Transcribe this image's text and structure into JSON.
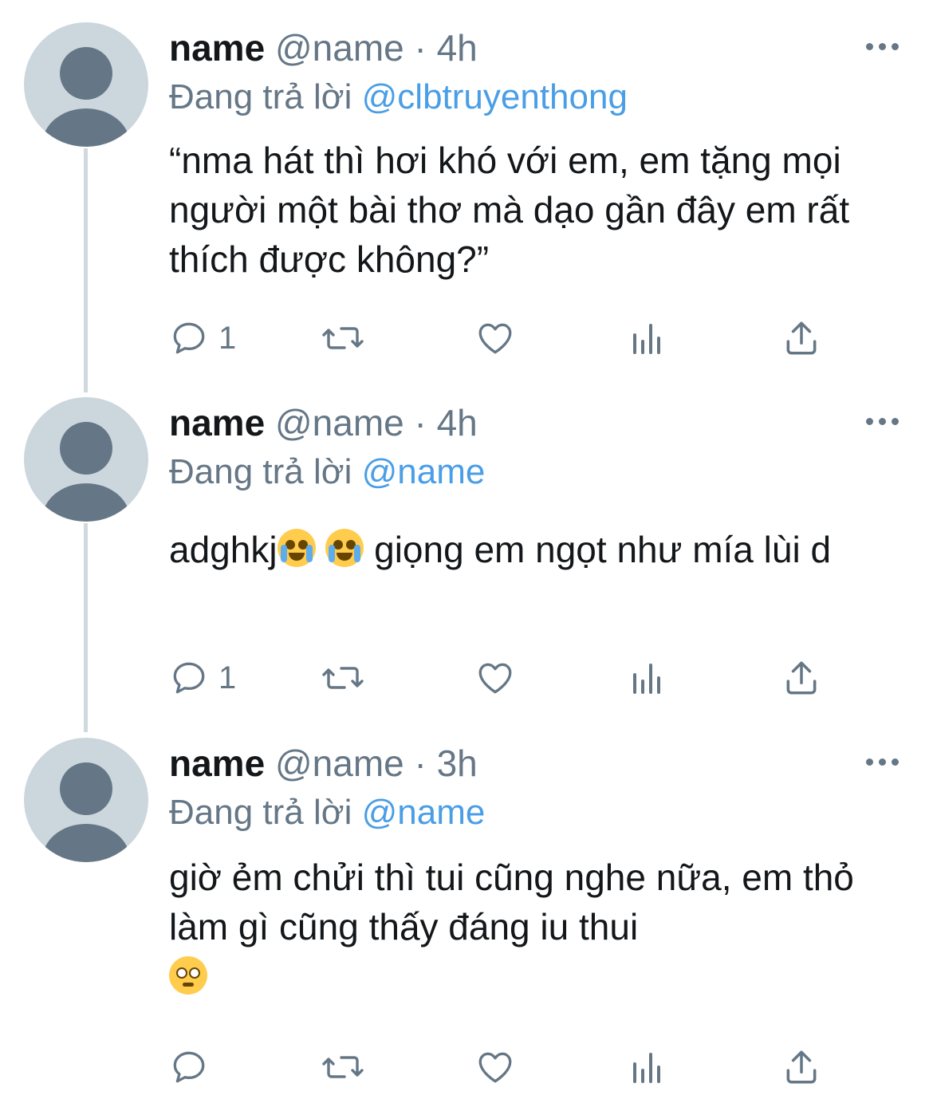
{
  "tweets": [
    {
      "name": "name",
      "meta": "@name · 4h",
      "replying_prefix": "Đang trả lời ",
      "replying_to": "@clbtruyenthong",
      "text": "“nma hát thì hơi khó với em, em tặng mọi người một bài thơ mà dạo gần đây em rất thích được không?”",
      "text_after_emoji": "",
      "reply_count": "1"
    },
    {
      "name": "name",
      "meta": "@name · 4h",
      "replying_prefix": "Đang trả lời ",
      "replying_to": "@name",
      "text": "adghkj",
      "text_after_emoji": " giọng em ngọt như mía lùi d",
      "reply_count": "1"
    },
    {
      "name": "name",
      "meta": "@name · 3h",
      "replying_prefix": "Đang trả lời ",
      "replying_to": "@name",
      "text": "giờ ẻm chửi thì tui cũng nghe nữa, em thỏ làm gì cũng thấy đáng iu thui",
      "text_after_emoji": "",
      "reply_count": ""
    }
  ],
  "emojis": {
    "tweet2": [
      "loudly-crying-face",
      "loudly-crying-face"
    ],
    "tweet3": [
      "pleading-face"
    ]
  },
  "icons": [
    "reply-icon",
    "retweet-icon",
    "like-icon",
    "analytics-icon",
    "share-icon",
    "more-icon"
  ],
  "colors": {
    "text": "#14171a",
    "secondary": "#657786",
    "link": "#4a9ee6",
    "avatar_bg": "#ccd6dd",
    "thread_line": "#cfd9de"
  }
}
